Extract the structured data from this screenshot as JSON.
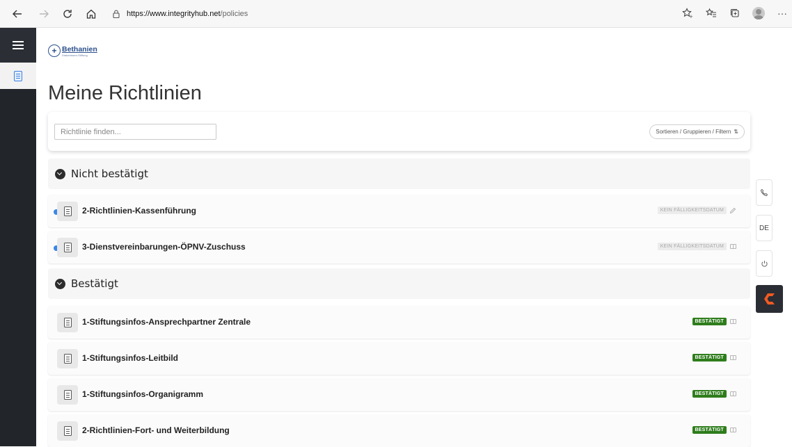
{
  "browser": {
    "url_host": "https://www.integrityhub.net",
    "url_path": "/policies"
  },
  "logo": {
    "name": "Bethanien",
    "subtitle": "Diakonissen-Stiftung"
  },
  "page": {
    "title": "Meine Richtlinien"
  },
  "search": {
    "placeholder": "Richtlinie finden...",
    "filter_label": "Sortieren / Gruppieren / Filtern",
    "filter_icon": "⇅"
  },
  "sections": [
    {
      "title": "Nicht bestätigt",
      "items": [
        {
          "title": "2-Richtlinien-Kassenführung",
          "status": "KEIN FÄLLIGKEITSDATUM",
          "status_type": "none",
          "action_icon": "pencil-icon"
        },
        {
          "title": "3-Dienstvereinbarungen-ÖPNV-Zuschuss",
          "status": "KEIN FÄLLIGKEITSDATUM",
          "status_type": "none",
          "action_icon": "book-icon"
        }
      ]
    },
    {
      "title": "Bestätigt",
      "items": [
        {
          "title": "1-Stiftungsinfos-Ansprechpartner Zentrale",
          "status": "BESTÄTIGT",
          "status_type": "confirmed",
          "action_icon": "book-icon"
        },
        {
          "title": "1-Stiftungsinfos-Leitbild",
          "status": "BESTÄTIGT",
          "status_type": "confirmed",
          "action_icon": "book-icon"
        },
        {
          "title": "1-Stiftungsinfos-Organigramm",
          "status": "BESTÄTIGT",
          "status_type": "confirmed",
          "action_icon": "book-icon"
        },
        {
          "title": "2-Richtlinien-Fort- und Weiterbildung",
          "status": "BESTÄTIGT",
          "status_type": "confirmed",
          "action_icon": "book-icon"
        }
      ]
    }
  ],
  "side_buttons": {
    "language": "DE"
  },
  "colors": {
    "sidebar_bg": "#22262b",
    "confirmed_badge": "#2e7d1c",
    "unread_dot": "#3b86e8",
    "brand_orange": "#f05a22"
  }
}
